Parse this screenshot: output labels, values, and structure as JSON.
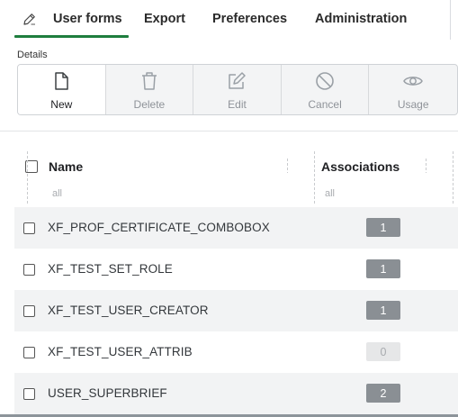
{
  "nav": {
    "tabs": [
      {
        "label": "User forms",
        "active": true
      },
      {
        "label": "Export"
      },
      {
        "label": "Preferences"
      },
      {
        "label": "Administration"
      }
    ],
    "accent_color": "#1e7e3e"
  },
  "details": {
    "label": "Details",
    "buttons": [
      {
        "label": "New",
        "icon": "new-document-icon",
        "enabled": true
      },
      {
        "label": "Delete",
        "icon": "trash-icon",
        "enabled": false
      },
      {
        "label": "Edit",
        "icon": "edit-icon",
        "enabled": false
      },
      {
        "label": "Cancel",
        "icon": "cancel-icon",
        "enabled": false
      },
      {
        "label": "Usage",
        "icon": "eye-icon",
        "enabled": false
      }
    ]
  },
  "grid": {
    "columns": [
      {
        "label": "Name",
        "filter_placeholder": "all"
      },
      {
        "label": "Associations",
        "filter_placeholder": "all"
      }
    ],
    "rows": [
      {
        "name": "XF_PROF_CERTIFICATE_COMBOBOX",
        "associations": "1"
      },
      {
        "name": "XF_TEST_SET_ROLE",
        "associations": "1"
      },
      {
        "name": "XF_TEST_USER_CREATOR",
        "associations": "1"
      },
      {
        "name": "XF_TEST_USER_ATTRIB",
        "associations": "0"
      },
      {
        "name": "USER_SUPERBRIEF",
        "associations": "2"
      }
    ]
  }
}
